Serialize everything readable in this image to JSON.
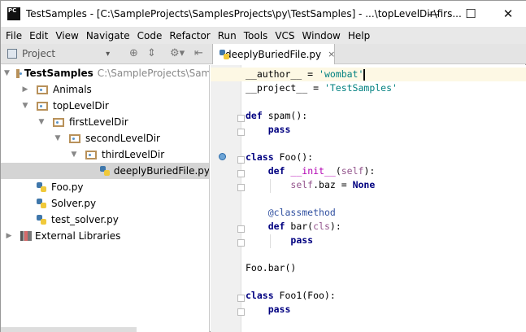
{
  "window": {
    "title": "TestSamples - [C:\\SampleProjects\\SamplesProjects\\py\\TestSamples] - ...\\topLevelDir\\firs...",
    "logo": "PC",
    "minimize": "—",
    "maximize": "☐",
    "close": "✕"
  },
  "menu": [
    "File",
    "Edit",
    "View",
    "Navigate",
    "Code",
    "Refactor",
    "Run",
    "Tools",
    "VCS",
    "Window",
    "Help"
  ],
  "toolbar": {
    "project_label": "Project",
    "dropdown": "▾",
    "locate": "⊕",
    "collapse": "⇕",
    "settings": "⚙▾",
    "hide": "⇤"
  },
  "editor_tab": {
    "label": "deeplyBuriedFile.py",
    "close": "×"
  },
  "tree": [
    {
      "label": "TestSamples",
      "path": "C:\\SampleProjects\\SamplesProjects\\py\\TestSamples",
      "depth": 0,
      "arrow": "▼",
      "type": "folder",
      "bold": true
    },
    {
      "label": "Animals",
      "depth": 1,
      "arrow": "▶",
      "type": "folder"
    },
    {
      "label": "topLevelDir",
      "depth": 1,
      "arrow": "▼",
      "type": "folder"
    },
    {
      "label": "firstLevelDir",
      "depth": 2,
      "arrow": "▼",
      "type": "folder"
    },
    {
      "label": "secondLevelDir",
      "depth": 3,
      "arrow": "▼",
      "type": "folder"
    },
    {
      "label": "thirdLevelDir",
      "depth": 4,
      "arrow": "▼",
      "type": "folder"
    },
    {
      "label": "deeplyBuriedFile.py",
      "depth": 5,
      "arrow": "",
      "type": "py",
      "selected": true
    },
    {
      "label": "Foo.py",
      "depth": 1,
      "arrow": "",
      "type": "py"
    },
    {
      "label": "Solver.py",
      "depth": 1,
      "arrow": "",
      "type": "py"
    },
    {
      "label": "test_solver.py",
      "depth": 1,
      "arrow": "",
      "type": "py"
    },
    {
      "label": "External Libraries",
      "depth": 0,
      "arrow": "▶",
      "type": "lib"
    }
  ],
  "code": [
    [
      [
        "__author__ = ",
        ""
      ],
      [
        "'wombat'",
        "str"
      ]
    ],
    [
      [
        "__project__ = ",
        ""
      ],
      [
        "'TestSamples'",
        "str"
      ]
    ],
    [],
    [
      [
        "def",
        "kw"
      ],
      [
        " spam():",
        ""
      ]
    ],
    [
      [
        "    ",
        ""
      ],
      [
        "pass",
        "kw"
      ]
    ],
    [],
    [
      [
        "class",
        "kw"
      ],
      [
        " Foo():",
        ""
      ]
    ],
    [
      [
        "    ",
        ""
      ],
      [
        "def",
        "kw"
      ],
      [
        " ",
        ""
      ],
      [
        "__init__",
        "magic"
      ],
      [
        "(",
        ""
      ],
      [
        "self",
        "selfp"
      ],
      [
        "):",
        ""
      ]
    ],
    [
      [
        "        ",
        ""
      ],
      [
        "self",
        "selfp"
      ],
      [
        ".baz = ",
        ""
      ],
      [
        "None",
        "kw"
      ]
    ],
    [],
    [
      [
        "    ",
        ""
      ],
      [
        "@classmethod",
        "deco"
      ]
    ],
    [
      [
        "    ",
        ""
      ],
      [
        "def",
        "kw"
      ],
      [
        " bar(",
        ""
      ],
      [
        "cls",
        "selfp"
      ],
      [
        "):",
        ""
      ]
    ],
    [
      [
        "        ",
        ""
      ],
      [
        "pass",
        "kw"
      ]
    ],
    [],
    [
      [
        "Foo.bar()",
        ""
      ]
    ],
    [],
    [
      [
        "class",
        "kw"
      ],
      [
        " Foo1(Foo):",
        ""
      ]
    ],
    [
      [
        "    ",
        ""
      ],
      [
        "pass",
        "kw"
      ]
    ]
  ]
}
